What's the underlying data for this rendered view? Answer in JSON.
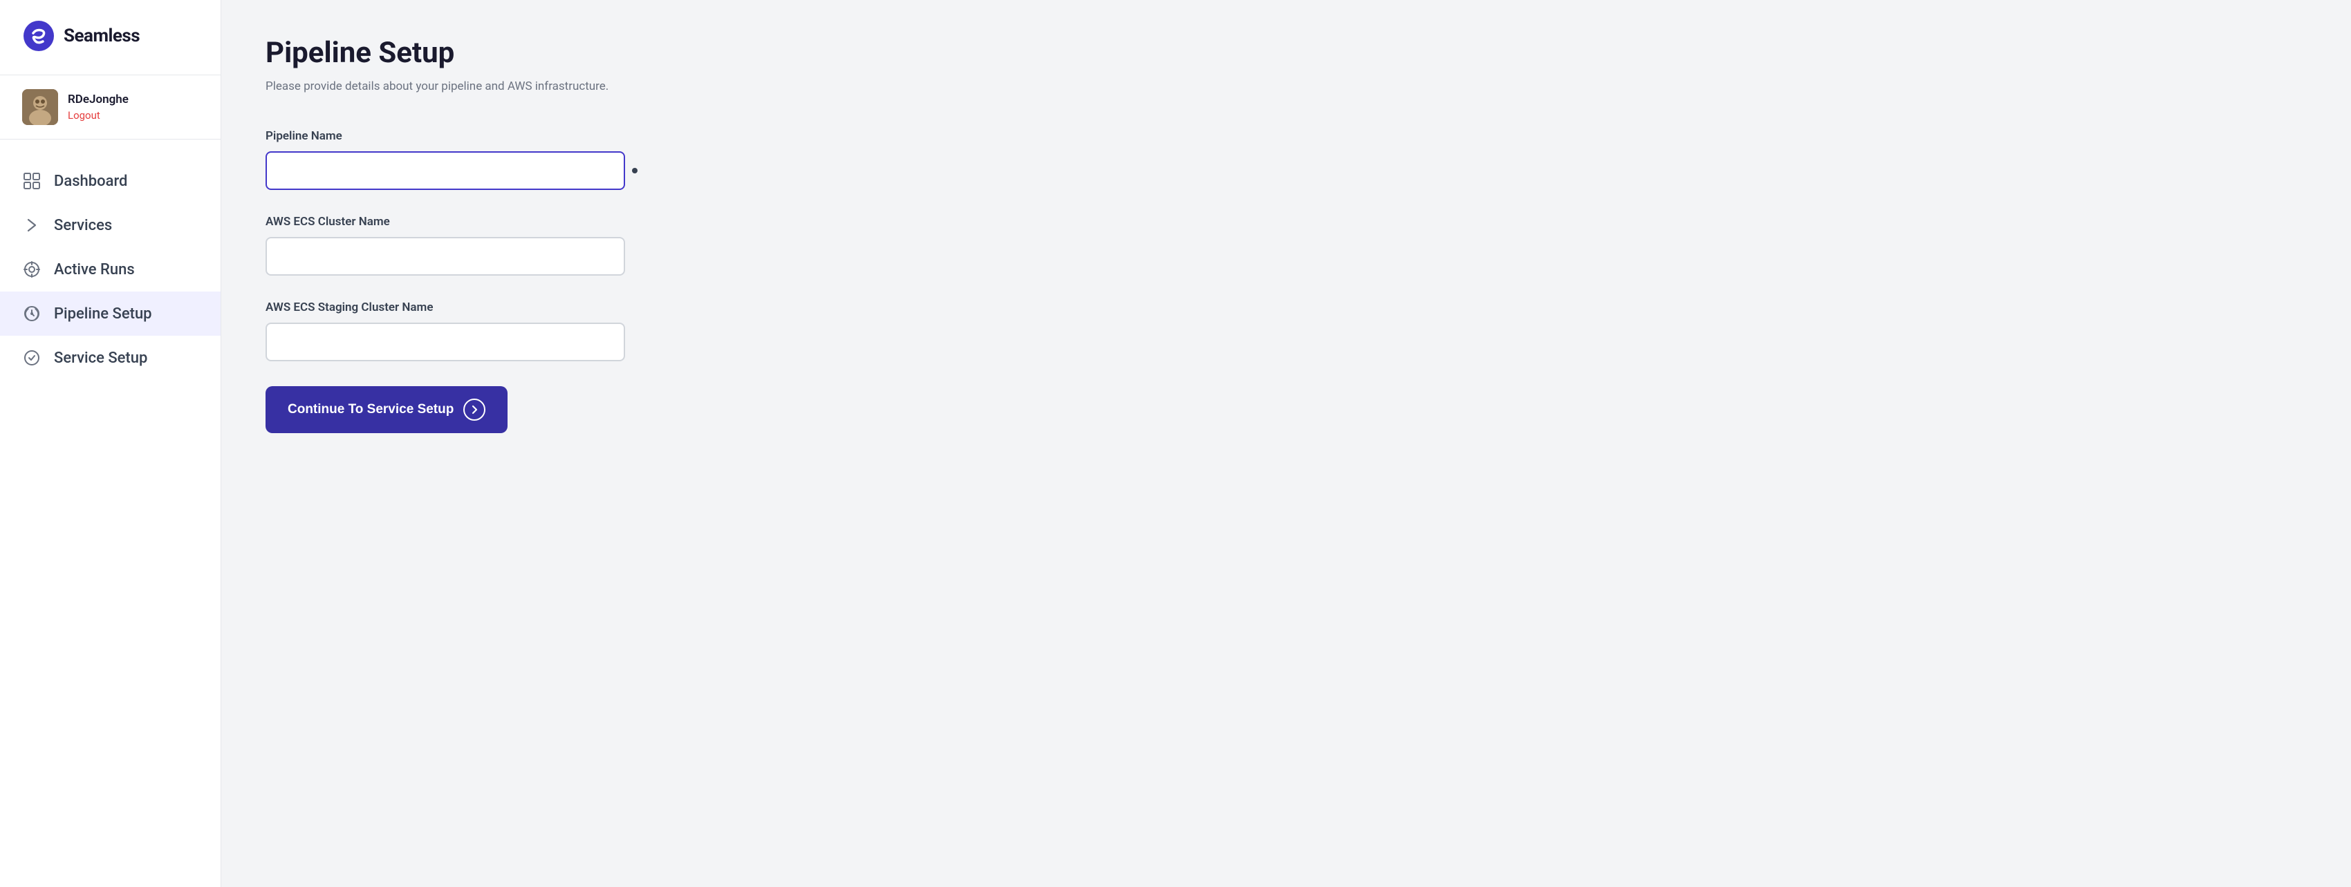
{
  "app": {
    "name": "Seamless"
  },
  "user": {
    "username": "RDeJonghe",
    "logout_label": "Logout"
  },
  "sidebar": {
    "nav_items": [
      {
        "id": "dashboard",
        "label": "Dashboard",
        "icon": "dashboard-icon",
        "active": false
      },
      {
        "id": "services",
        "label": "Services",
        "icon": "services-icon",
        "active": false
      },
      {
        "id": "active-runs",
        "label": "Active Runs",
        "icon": "active-runs-icon",
        "active": false
      },
      {
        "id": "pipeline-setup",
        "label": "Pipeline Setup",
        "icon": "pipeline-setup-icon",
        "active": true
      },
      {
        "id": "service-setup",
        "label": "Service Setup",
        "icon": "service-setup-icon",
        "active": false
      }
    ]
  },
  "main": {
    "page_title": "Pipeline Setup",
    "page_subtitle": "Please provide details about your pipeline and AWS infrastructure.",
    "form": {
      "pipeline_name_label": "Pipeline Name",
      "pipeline_name_placeholder": "",
      "aws_cluster_label": "AWS ECS Cluster Name",
      "aws_cluster_placeholder": "",
      "aws_staging_label": "AWS ECS Staging Cluster Name",
      "aws_staging_placeholder": "",
      "continue_button_label": "Continue To Service Setup"
    }
  }
}
